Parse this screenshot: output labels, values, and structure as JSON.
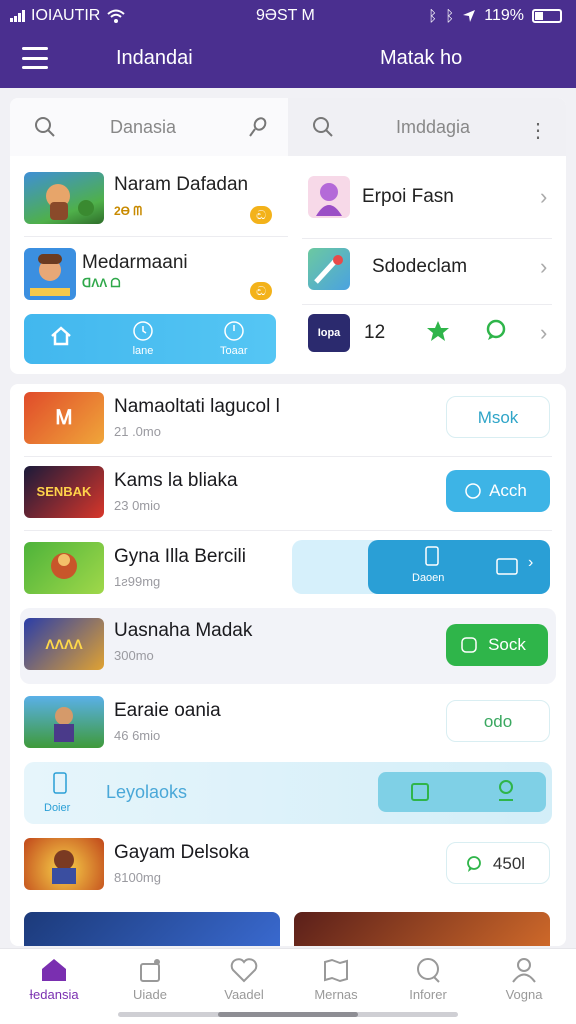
{
  "status": {
    "carrier": "IOIAUTIR",
    "time": "9ƏST M",
    "battery": "119%"
  },
  "appbar": {
    "title_left": "Indandai",
    "title_right": "Matak ho"
  },
  "search": {
    "left_placeholder": "Danasia",
    "right_placeholder": "Imddagia"
  },
  "featured_left": [
    {
      "name": "Naram Dafadan",
      "tag": "2Ɵ ᗰ",
      "coin": "ඬ"
    },
    {
      "name": "Medarmaani",
      "tag": "ᗡɅɅ ᗝ",
      "coin": "ඬ"
    }
  ],
  "featured_right": [
    {
      "name": "Erpoi Fasn"
    },
    {
      "name": "Sdodeclam"
    },
    {
      "name": "12",
      "logo_text": "Iopa"
    }
  ],
  "quickbar": {
    "items": [
      {
        "label": ""
      },
      {
        "label": "lane"
      },
      {
        "label": "Toaar"
      }
    ]
  },
  "list": [
    {
      "name": "Namaoltati lagucol l",
      "sub": "21 .0mo",
      "action": "Msok",
      "style": "outline",
      "thumb_text": "Ꮇ"
    },
    {
      "name": "Kams la bliaka",
      "sub": "23 0mio",
      "action": "Acch",
      "style": "blue",
      "thumb_text": "SENBAK"
    },
    {
      "name": "Gyna Illa Bercili",
      "sub": "1ƨ99mg",
      "action": "Daoen",
      "style": "expanded"
    },
    {
      "name": "Uasnaha Madak",
      "sub": "300mo",
      "action": "Sock",
      "style": "green",
      "thumb_text": "ɅɅɅɅ"
    },
    {
      "name": "Earaie oania",
      "sub": "46 6mio",
      "action": "odo",
      "style": "outline-green"
    },
    {
      "name": "Gayam Delsoka",
      "sub": "8100mg",
      "action": "450l",
      "style": "outline-chat"
    }
  ],
  "promo": {
    "label": "Leyolaoks",
    "left_caption": "Doier"
  },
  "bottom_nav": [
    {
      "label": "Ɨedansia",
      "icon": "home-icon",
      "active": true
    },
    {
      "label": "Uiade",
      "icon": "bag-icon",
      "active": false
    },
    {
      "label": "Vaadel",
      "icon": "heart-icon",
      "active": false
    },
    {
      "label": "Mernas",
      "icon": "map-icon",
      "active": false
    },
    {
      "label": "Inforer",
      "icon": "chat-icon",
      "active": false
    },
    {
      "label": "Vogna",
      "icon": "profile-icon",
      "active": false
    }
  ],
  "colors": {
    "appbar": "#4a2f8f",
    "accent_blue": "#3db4e6",
    "accent_green": "#2fb54a",
    "active_nav": "#7a2fb0"
  }
}
